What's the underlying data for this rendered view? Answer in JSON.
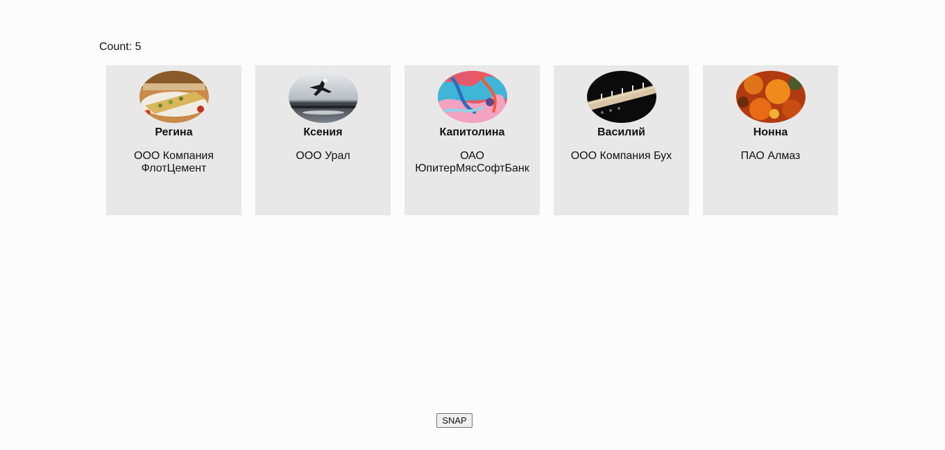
{
  "count_label": "Count: 5",
  "cards": [
    {
      "name": "Регина",
      "company": "ООО Компания ФлотЦемент",
      "avatar_icon": "food-photo"
    },
    {
      "name": "Ксения",
      "company": "ООО Урал",
      "avatar_icon": "jump-silhouette-photo"
    },
    {
      "name": "Капитолина",
      "company": "ОАО ЮпитерМясСофтБанк",
      "avatar_icon": "abstract-paint-photo"
    },
    {
      "name": "Василий",
      "company": "ООО Компания Бух",
      "avatar_icon": "runway-photo"
    },
    {
      "name": "Нонна",
      "company": "ПАО Алмаз",
      "avatar_icon": "autumn-leaves-photo"
    }
  ],
  "snap_label": "SNAP"
}
